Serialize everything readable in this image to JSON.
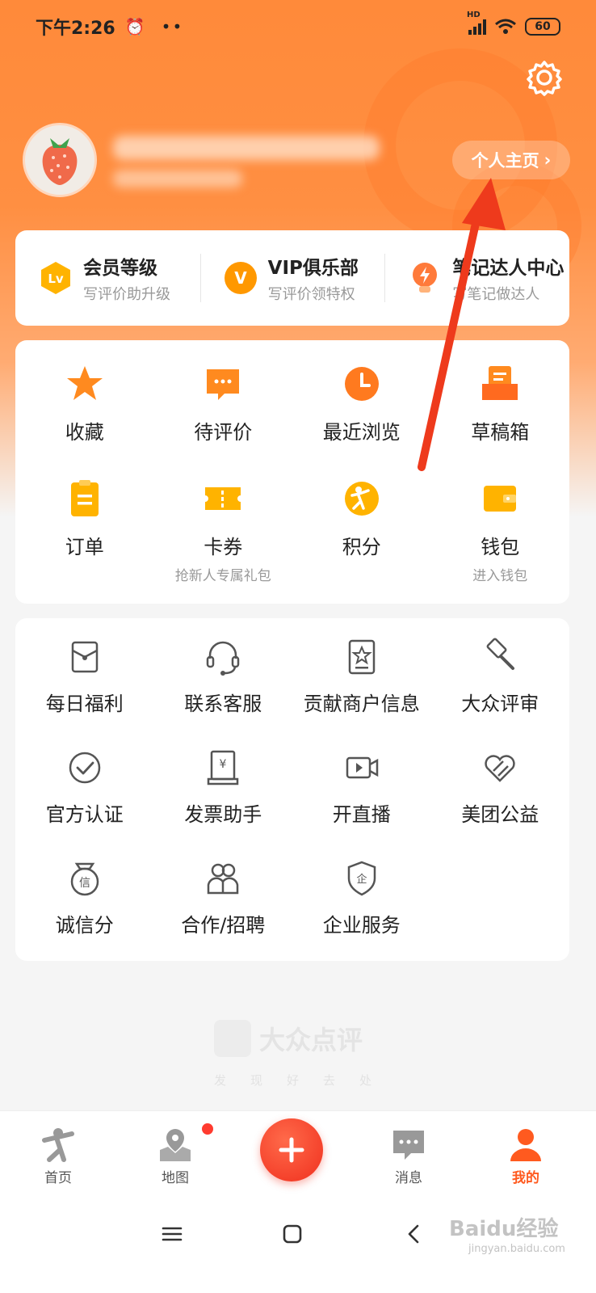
{
  "status_bar": {
    "time": "下午2:26",
    "hd": "HD",
    "battery": "60"
  },
  "profile": {
    "home_button": "个人主页"
  },
  "member_card": [
    {
      "title": "会员等级",
      "sub": "写评价助升级",
      "badge": "Lv",
      "color": "#ffb300"
    },
    {
      "title": "VIP俱乐部",
      "sub": "写评价领特权",
      "badge": "V",
      "color": "#ff9800"
    },
    {
      "title": "笔记达人中心",
      "sub": "写笔记做达人",
      "badge": "⚡",
      "color": "#ff7a3a"
    }
  ],
  "main_grid": [
    {
      "label": "收藏",
      "sub": "",
      "icon": "star-icon"
    },
    {
      "label": "待评价",
      "sub": "",
      "icon": "comment-icon"
    },
    {
      "label": "最近浏览",
      "sub": "",
      "icon": "clock-icon"
    },
    {
      "label": "草稿箱",
      "sub": "",
      "icon": "drafts-icon"
    },
    {
      "label": "订单",
      "sub": "",
      "icon": "order-icon"
    },
    {
      "label": "卡券",
      "sub": "抢新人专属礼包",
      "icon": "coupon-icon"
    },
    {
      "label": "积分",
      "sub": "",
      "icon": "points-icon"
    },
    {
      "label": "钱包",
      "sub": "进入钱包",
      "icon": "wallet-icon"
    }
  ],
  "service_grid": [
    {
      "label": "每日福利",
      "icon": "gift-icon"
    },
    {
      "label": "联系客服",
      "icon": "headset-icon"
    },
    {
      "label": "贡献商户信息",
      "icon": "shop-info-icon"
    },
    {
      "label": "大众评审",
      "icon": "gavel-icon"
    },
    {
      "label": "官方认证",
      "icon": "verified-icon"
    },
    {
      "label": "发票助手",
      "icon": "invoice-icon"
    },
    {
      "label": "开直播",
      "icon": "live-icon"
    },
    {
      "label": "美团公益",
      "icon": "charity-icon"
    },
    {
      "label": "诚信分",
      "icon": "credit-icon"
    },
    {
      "label": "合作/招聘",
      "icon": "recruit-icon"
    },
    {
      "label": "企业服务",
      "icon": "enterprise-icon"
    }
  ],
  "brand": {
    "name": "大众点评",
    "slogan": [
      "发",
      "现",
      "好",
      "去",
      "处"
    ]
  },
  "tabbar": {
    "home": "首页",
    "map": "地图",
    "messages": "消息",
    "mine": "我的"
  },
  "watermark": {
    "text": "Baidu经验",
    "url": "jingyan.baidu.com"
  },
  "colors": {
    "accent": "#ff5a1f",
    "header": "#ff8a3a",
    "icon_orange": "#ff8a1f",
    "icon_gray": "#555555"
  }
}
